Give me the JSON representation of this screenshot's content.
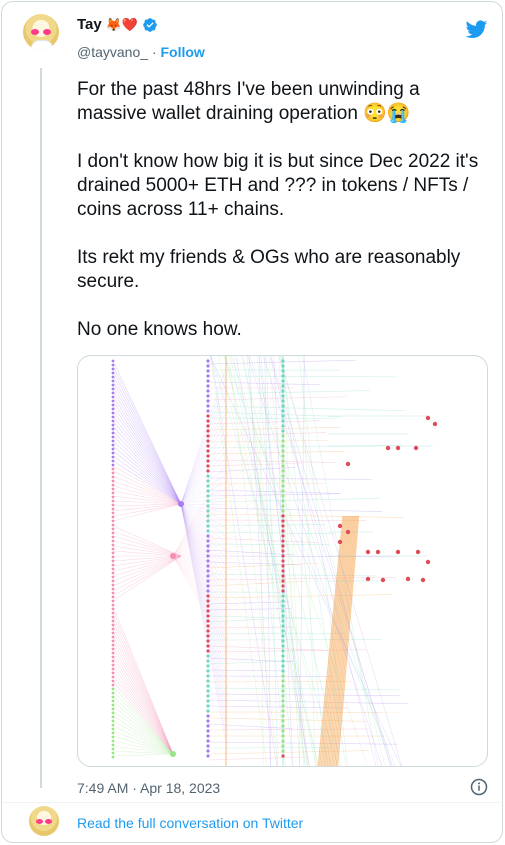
{
  "author": {
    "name": "Tay",
    "name_emojis": "🦊❤️",
    "handle": "@tayvano_",
    "separator": " · ",
    "follow_label": "Follow",
    "verified": true
  },
  "tweet": {
    "paragraphs": [
      "For the past 48hrs I've been unwinding a massive wallet draining operation 😳😭",
      "I don't know how big it is but since Dec 2022 it's drained 5000+ ETH and ??? in tokens / NFTs / coins across 11+ chains.",
      "Its rekt my friends & OGs who are reasonably secure.",
      "No one knows how."
    ],
    "timestamp": "7:49 AM · Apr 18, 2023"
  },
  "footer": {
    "read_link": "Read the full conversation on Twitter"
  },
  "icons": {
    "platform": "twitter-bird-icon",
    "verified": "verified-badge-icon",
    "info": "info-icon"
  },
  "colors": {
    "accent": "#1d9bf0",
    "secondary_text": "#536471",
    "border": "#cfd9de",
    "graph_purple": "#a57cf0",
    "graph_pink": "#f48fb1",
    "graph_green": "#9be38a",
    "graph_teal": "#6fd6c0",
    "graph_orange": "#f7a34b",
    "graph_red": "#e04b5a"
  }
}
